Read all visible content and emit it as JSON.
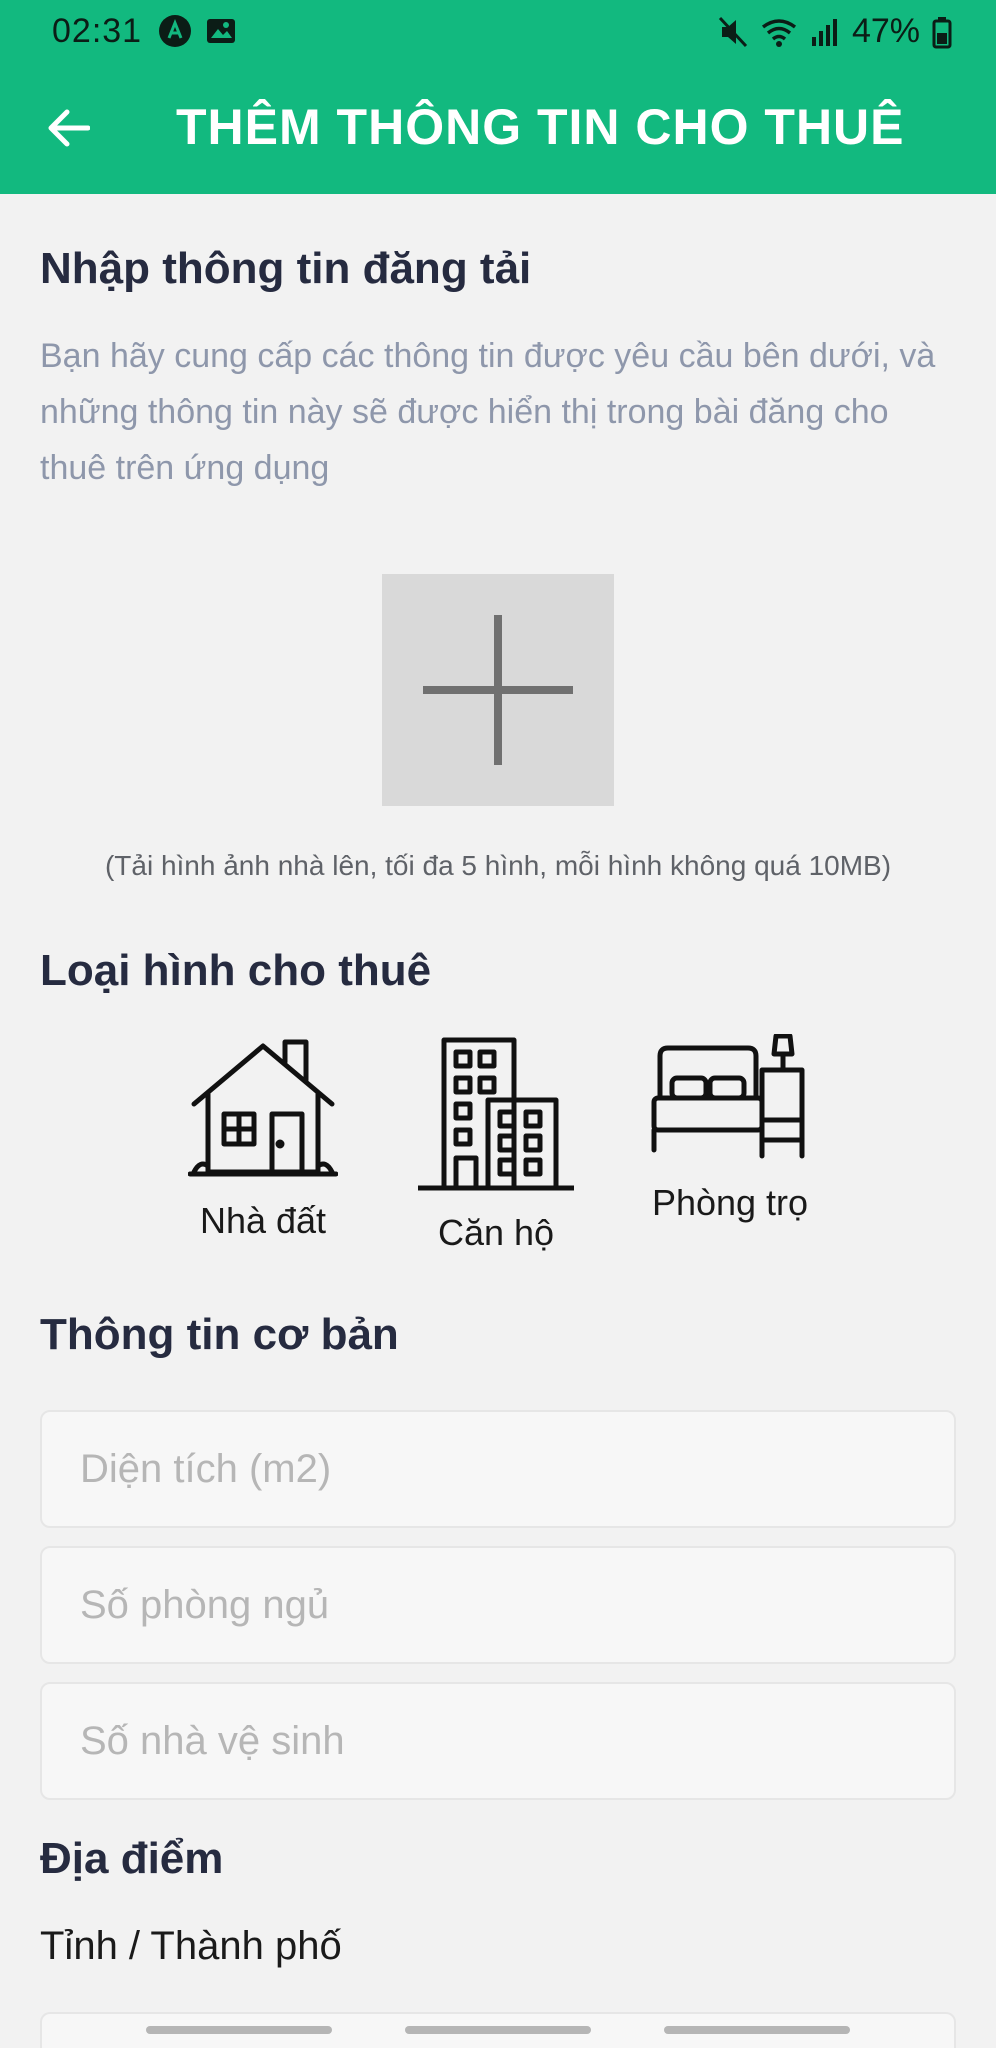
{
  "status_bar": {
    "time": "02:31",
    "battery": "47%"
  },
  "app_bar": {
    "title": "THÊM THÔNG TIN CHO THUÊ",
    "back_icon": "arrow-left-icon"
  },
  "intro": {
    "title": "Nhập thông tin đăng tải",
    "description": "Bạn hãy cung cấp các thông tin được yêu cầu bên dưới, và những thông tin này sẽ được hiển thị trong bài đăng cho thuê trên ứng dụng"
  },
  "upload": {
    "icon": "plus-icon",
    "hint": "(Tải hình ảnh nhà lên, tối đa 5 hình, mỗi hình không quá 10MB)"
  },
  "rental_type": {
    "title": "Loại hình cho thuê",
    "items": [
      {
        "label": "Nhà đất",
        "icon": "house-icon"
      },
      {
        "label": "Căn hộ",
        "icon": "apartment-building-icon"
      },
      {
        "label": "Phòng trọ",
        "icon": "bedroom-icon"
      }
    ]
  },
  "basic_info": {
    "title": "Thông tin cơ bản",
    "area_placeholder": "Diện tích (m2)",
    "bedrooms_placeholder": "Số phòng ngủ",
    "bathrooms_placeholder": "Số nhà vệ sinh"
  },
  "location": {
    "title": "Địa điểm",
    "province_label": "Tỉnh / Thành phố"
  },
  "colors": {
    "primary": "#12b97f",
    "background": "#f2f2f2",
    "heading": "#262b40",
    "muted": "#8e97ab"
  }
}
